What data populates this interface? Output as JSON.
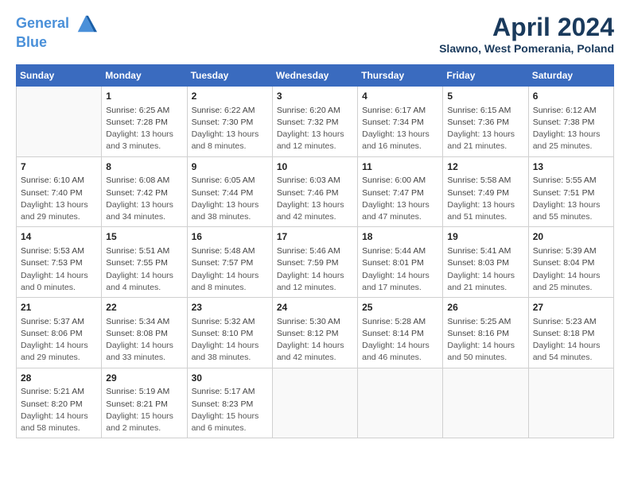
{
  "header": {
    "logo_line1": "General",
    "logo_line2": "Blue",
    "month": "April 2024",
    "location": "Slawno, West Pomerania, Poland"
  },
  "weekdays": [
    "Sunday",
    "Monday",
    "Tuesday",
    "Wednesday",
    "Thursday",
    "Friday",
    "Saturday"
  ],
  "weeks": [
    [
      {
        "day": "",
        "sunrise": "",
        "sunset": "",
        "daylight": ""
      },
      {
        "day": "1",
        "sunrise": "6:25 AM",
        "sunset": "7:28 PM",
        "daylight": "13 hours and 3 minutes."
      },
      {
        "day": "2",
        "sunrise": "6:22 AM",
        "sunset": "7:30 PM",
        "daylight": "13 hours and 8 minutes."
      },
      {
        "day": "3",
        "sunrise": "6:20 AM",
        "sunset": "7:32 PM",
        "daylight": "13 hours and 12 minutes."
      },
      {
        "day": "4",
        "sunrise": "6:17 AM",
        "sunset": "7:34 PM",
        "daylight": "13 hours and 16 minutes."
      },
      {
        "day": "5",
        "sunrise": "6:15 AM",
        "sunset": "7:36 PM",
        "daylight": "13 hours and 21 minutes."
      },
      {
        "day": "6",
        "sunrise": "6:12 AM",
        "sunset": "7:38 PM",
        "daylight": "13 hours and 25 minutes."
      }
    ],
    [
      {
        "day": "7",
        "sunrise": "6:10 AM",
        "sunset": "7:40 PM",
        "daylight": "13 hours and 29 minutes."
      },
      {
        "day": "8",
        "sunrise": "6:08 AM",
        "sunset": "7:42 PM",
        "daylight": "13 hours and 34 minutes."
      },
      {
        "day": "9",
        "sunrise": "6:05 AM",
        "sunset": "7:44 PM",
        "daylight": "13 hours and 38 minutes."
      },
      {
        "day": "10",
        "sunrise": "6:03 AM",
        "sunset": "7:46 PM",
        "daylight": "13 hours and 42 minutes."
      },
      {
        "day": "11",
        "sunrise": "6:00 AM",
        "sunset": "7:47 PM",
        "daylight": "13 hours and 47 minutes."
      },
      {
        "day": "12",
        "sunrise": "5:58 AM",
        "sunset": "7:49 PM",
        "daylight": "13 hours and 51 minutes."
      },
      {
        "day": "13",
        "sunrise": "5:55 AM",
        "sunset": "7:51 PM",
        "daylight": "13 hours and 55 minutes."
      }
    ],
    [
      {
        "day": "14",
        "sunrise": "5:53 AM",
        "sunset": "7:53 PM",
        "daylight": "14 hours and 0 minutes."
      },
      {
        "day": "15",
        "sunrise": "5:51 AM",
        "sunset": "7:55 PM",
        "daylight": "14 hours and 4 minutes."
      },
      {
        "day": "16",
        "sunrise": "5:48 AM",
        "sunset": "7:57 PM",
        "daylight": "14 hours and 8 minutes."
      },
      {
        "day": "17",
        "sunrise": "5:46 AM",
        "sunset": "7:59 PM",
        "daylight": "14 hours and 12 minutes."
      },
      {
        "day": "18",
        "sunrise": "5:44 AM",
        "sunset": "8:01 PM",
        "daylight": "14 hours and 17 minutes."
      },
      {
        "day": "19",
        "sunrise": "5:41 AM",
        "sunset": "8:03 PM",
        "daylight": "14 hours and 21 minutes."
      },
      {
        "day": "20",
        "sunrise": "5:39 AM",
        "sunset": "8:04 PM",
        "daylight": "14 hours and 25 minutes."
      }
    ],
    [
      {
        "day": "21",
        "sunrise": "5:37 AM",
        "sunset": "8:06 PM",
        "daylight": "14 hours and 29 minutes."
      },
      {
        "day": "22",
        "sunrise": "5:34 AM",
        "sunset": "8:08 PM",
        "daylight": "14 hours and 33 minutes."
      },
      {
        "day": "23",
        "sunrise": "5:32 AM",
        "sunset": "8:10 PM",
        "daylight": "14 hours and 38 minutes."
      },
      {
        "day": "24",
        "sunrise": "5:30 AM",
        "sunset": "8:12 PM",
        "daylight": "14 hours and 42 minutes."
      },
      {
        "day": "25",
        "sunrise": "5:28 AM",
        "sunset": "8:14 PM",
        "daylight": "14 hours and 46 minutes."
      },
      {
        "day": "26",
        "sunrise": "5:25 AM",
        "sunset": "8:16 PM",
        "daylight": "14 hours and 50 minutes."
      },
      {
        "day": "27",
        "sunrise": "5:23 AM",
        "sunset": "8:18 PM",
        "daylight": "14 hours and 54 minutes."
      }
    ],
    [
      {
        "day": "28",
        "sunrise": "5:21 AM",
        "sunset": "8:20 PM",
        "daylight": "14 hours and 58 minutes."
      },
      {
        "day": "29",
        "sunrise": "5:19 AM",
        "sunset": "8:21 PM",
        "daylight": "15 hours and 2 minutes."
      },
      {
        "day": "30",
        "sunrise": "5:17 AM",
        "sunset": "8:23 PM",
        "daylight": "15 hours and 6 minutes."
      },
      {
        "day": "",
        "sunrise": "",
        "sunset": "",
        "daylight": ""
      },
      {
        "day": "",
        "sunrise": "",
        "sunset": "",
        "daylight": ""
      },
      {
        "day": "",
        "sunrise": "",
        "sunset": "",
        "daylight": ""
      },
      {
        "day": "",
        "sunrise": "",
        "sunset": "",
        "daylight": ""
      }
    ]
  ]
}
